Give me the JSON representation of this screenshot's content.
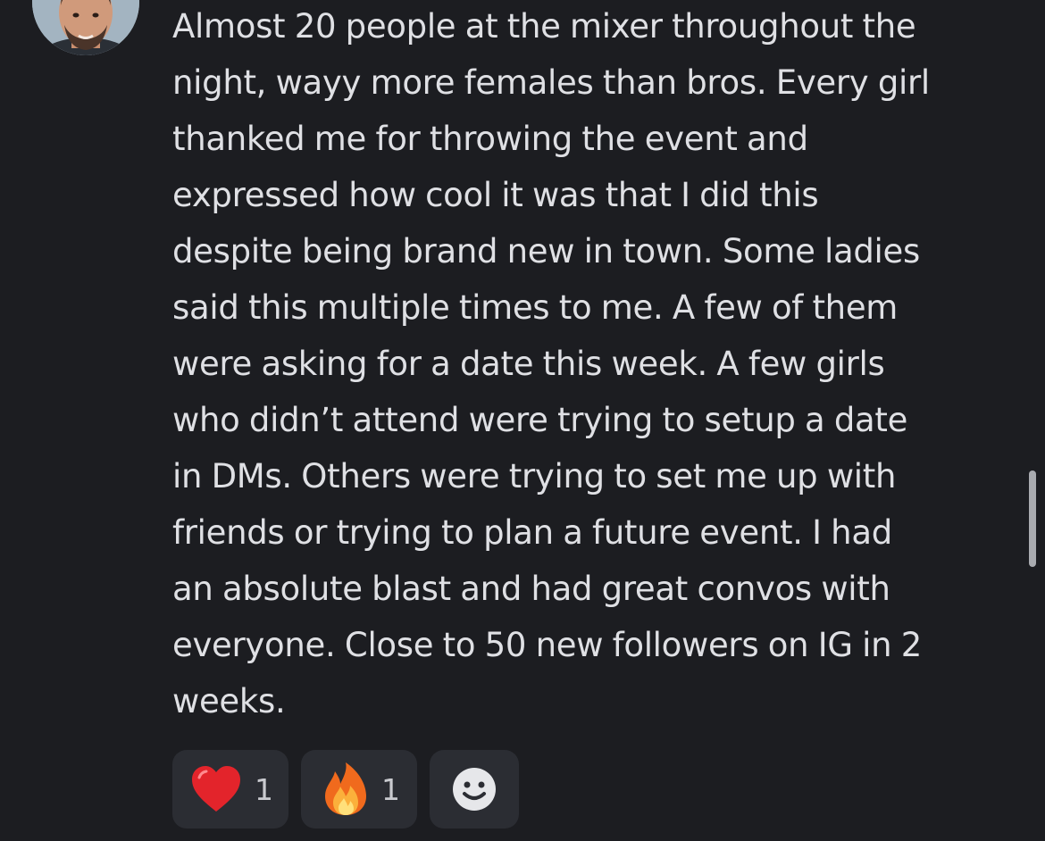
{
  "message": {
    "lines": [
      "Almost 20 people at the mixer throughout the",
      "night, wayy more females than bros. Every girl",
      "thanked me for throwing the event and",
      "expressed how cool it was that I did this",
      "despite being brand new in town. Some ladies",
      "said this multiple times to me. A few of them",
      "were asking for a date this week. A few girls",
      "who didn’t attend were trying to setup a date",
      "in DMs. Others were trying to set me up with",
      "friends or trying to plan a future event. I had",
      "an absolute blast and had great convos with",
      "everyone. Close to 50 new followers on IG in 2",
      "weeks."
    ]
  },
  "reactions": [
    {
      "emoji": "heart",
      "count": "1"
    },
    {
      "emoji": "fire",
      "count": "1"
    }
  ],
  "add_reaction_icon": "smiley-add-reaction-icon",
  "colors": {
    "background": "#1c1d21",
    "text": "#dfe0e4",
    "reaction_bg": "#2b2d33",
    "count_text": "#c9cacf",
    "scrollbar": "#a9abb0"
  }
}
